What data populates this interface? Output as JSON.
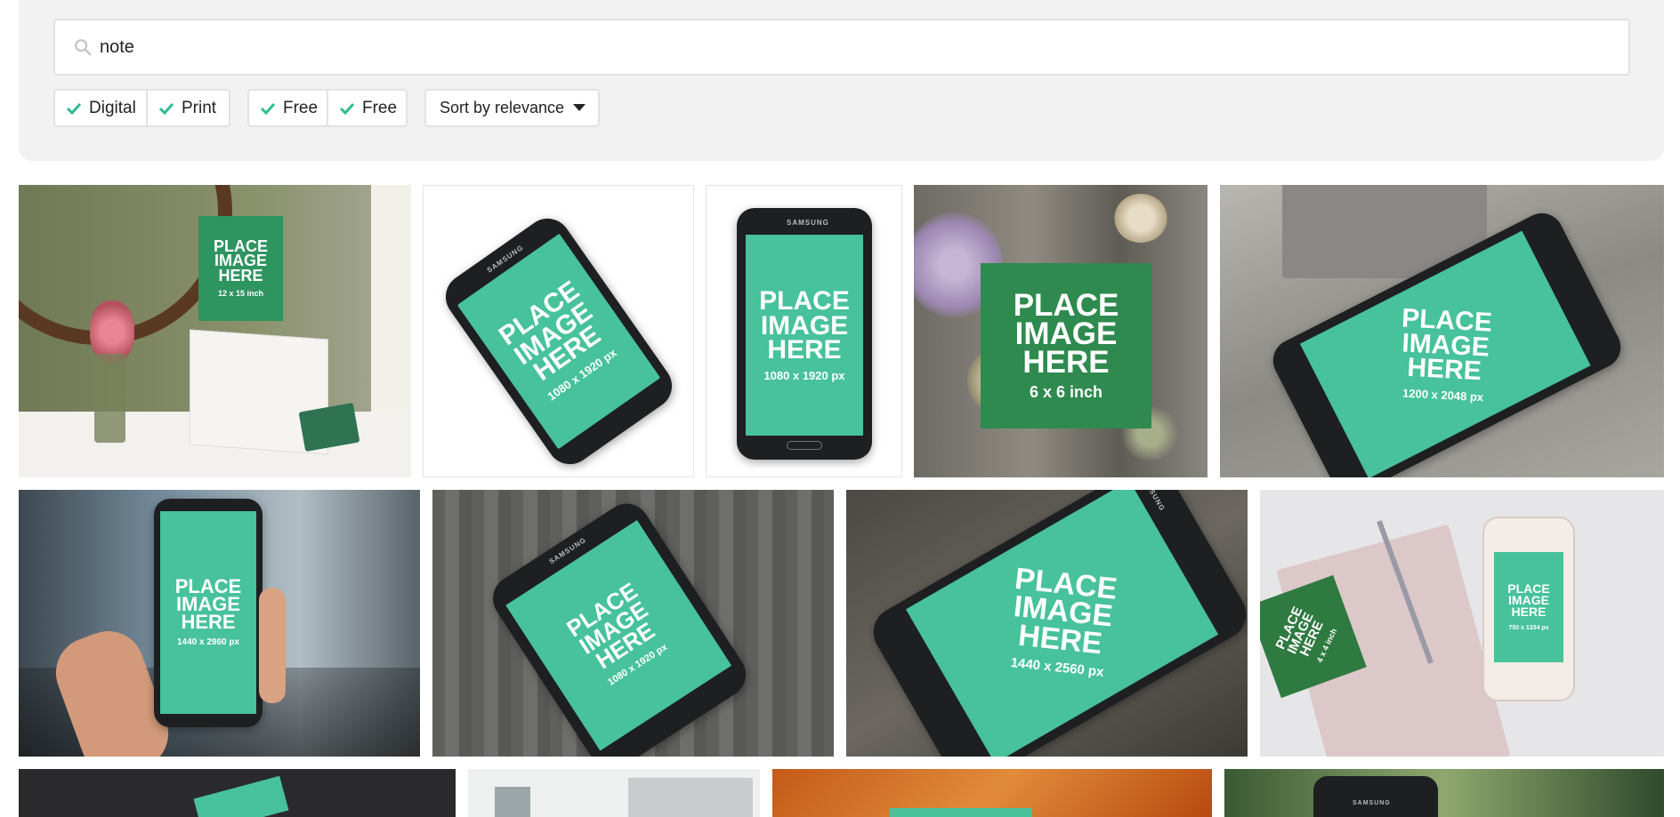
{
  "search": {
    "value": "note",
    "icon": "search-icon"
  },
  "filters": [
    {
      "label": "Digital",
      "checked": true
    },
    {
      "label": "Print",
      "checked": true
    },
    {
      "label": "Free",
      "checked": true
    },
    {
      "label": "Free",
      "checked": true
    }
  ],
  "sort": {
    "label": "Sort by relevance"
  },
  "colors": {
    "accent": "#47c29a",
    "check": "#2ebd8e",
    "panel": "#f2f2f2"
  },
  "mockups": [
    {
      "placeholder": "PLACE IMAGE HERE",
      "dims": "12 x 15 inch"
    },
    {
      "placeholder": "PLACE IMAGE HERE",
      "dims": "1080 x 1920 px",
      "brand": "SAMSUNG"
    },
    {
      "placeholder": "PLACE IMAGE HERE",
      "dims": "1080 x 1920 px",
      "brand": "SAMSUNG"
    },
    {
      "placeholder": "PLACE IMAGE HERE",
      "dims": "6 x 6 inch"
    },
    {
      "placeholder": "PLACE IMAGE HERE",
      "dims": "1200 x 2048 px"
    },
    {
      "placeholder": "PLACE IMAGE HERE",
      "dims": "1440 x 2960 px"
    },
    {
      "placeholder": "PLACE IMAGE HERE",
      "dims": "1080 x 1920 px",
      "brand": "SAMSUNG"
    },
    {
      "placeholder": "PLACE IMAGE HERE",
      "dims": "1440 x 2560 px",
      "brand": "SAMSUNG"
    },
    {
      "placeholder": "PLACE IMAGE HERE",
      "dims": "4 x 4 inch"
    },
    {
      "placeholder": "PLACE IMAGE HERE",
      "dims": "750 x 1334 px"
    },
    {
      "brand": "SAMSUNG"
    }
  ]
}
